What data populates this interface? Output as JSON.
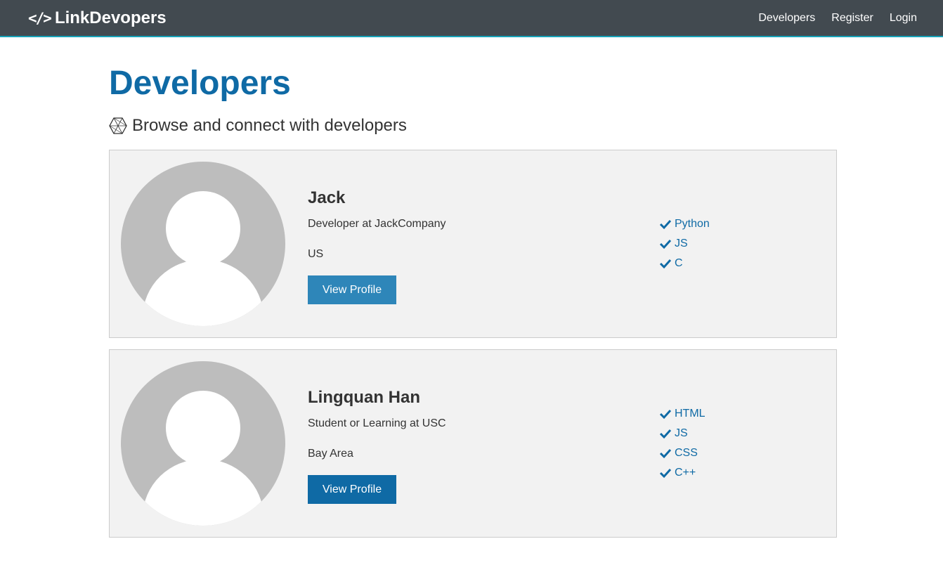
{
  "navbar": {
    "brand_icon": "</>",
    "brand": "LinkDevopers",
    "links": [
      {
        "label": "Developers"
      },
      {
        "label": "Register"
      },
      {
        "label": "Login"
      }
    ]
  },
  "page": {
    "title": "Developers",
    "lead": "Browse and connect with developers"
  },
  "profiles": [
    {
      "name": "Jack",
      "status": "Developer at JackCompany",
      "location": "US",
      "button": "View Profile",
      "skills": [
        "Python",
        "JS",
        "C"
      ]
    },
    {
      "name": "Lingquan Han",
      "status": "Student or Learning at USC",
      "location": "Bay Area",
      "button": "View Profile",
      "skills": [
        "HTML",
        "JS",
        "CSS",
        "C++"
      ]
    }
  ],
  "colors": {
    "navbar_bg": "#424a50",
    "primary": "#0f6aa5",
    "card_bg": "#f2f2f2"
  }
}
